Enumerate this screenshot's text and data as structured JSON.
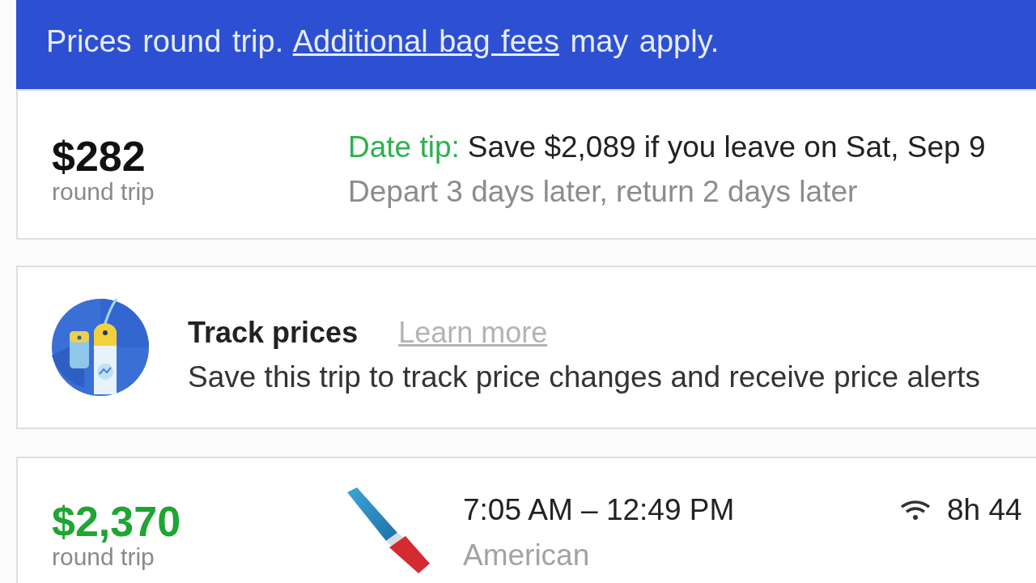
{
  "notice_bar": {
    "text_before": "Prices round trip.",
    "link": "Additional bag fees",
    "text_after": "may apply."
  },
  "date_tip_card": {
    "price": "$282",
    "price_note": "round trip",
    "tip_label": "Date tip:",
    "tip_text": "Save $2,089 if you leave on Sat, Sep 9",
    "detail": "Depart 3 days later, return 2 days later"
  },
  "track_prices_card": {
    "title": "Track prices",
    "link": "Learn more",
    "description": "Save this trip to track price changes and receive price alerts"
  },
  "flights": [
    {
      "price": "$2,370",
      "price_note": "round trip",
      "highlighted": true,
      "times": "7:05 AM – 12:49 PM",
      "airline": "American",
      "wifi": true,
      "duration": "8h 44"
    }
  ]
}
